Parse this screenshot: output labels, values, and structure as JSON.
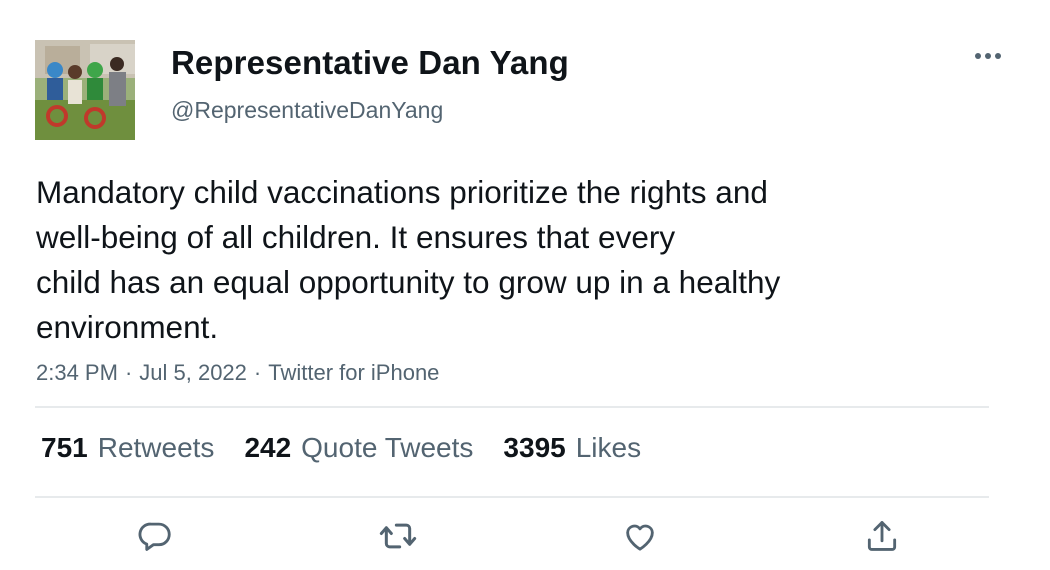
{
  "author": {
    "display_name": "Representative Dan Yang",
    "handle": "@RepresentativeDanYang",
    "avatar_icon": "family-photo-avatar"
  },
  "tweet": {
    "text_lines": [
      "Mandatory child vaccinations prioritize the rights and",
      "well-being of all children. It ensures that every",
      "child has an equal opportunity to grow up in a healthy",
      "environment."
    ],
    "time": "2:34 PM",
    "date": "Jul 5, 2022",
    "source": "Twitter for iPhone",
    "separator": "·"
  },
  "stats": {
    "retweets": {
      "count": "751",
      "label": "Retweets"
    },
    "quote_tweets": {
      "count": "242",
      "label": "Quote Tweets"
    },
    "likes": {
      "count": "3395",
      "label": "Likes"
    }
  },
  "actions": {
    "reply_icon": "reply-icon",
    "retweet_icon": "retweet-icon",
    "like_icon": "heart-icon",
    "share_icon": "share-icon",
    "more_icon": "more-icon"
  },
  "colors": {
    "text": "#0f1419",
    "secondary": "#536471",
    "divider": "#e7eaec",
    "icon": "#536471"
  }
}
